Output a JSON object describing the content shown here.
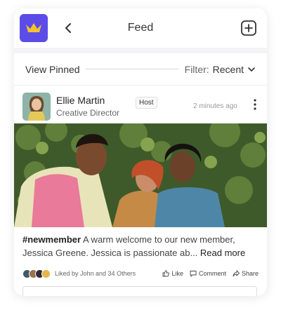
{
  "header": {
    "title": "Feed",
    "logo_icon": "crown-icon",
    "back_icon": "chevron-left-icon",
    "add_icon": "plus-square-icon",
    "brand_color": "#5b4ce8"
  },
  "filterbar": {
    "pinned_label": "View Pinned",
    "filter_label": "Filter:",
    "filter_value": "Recent"
  },
  "post": {
    "author": "Ellie Martin",
    "role": "Creative Director",
    "badge": "Host",
    "time": "2 minutes ago",
    "hashtag": "#newmember",
    "body": " A warm welcome to our new member, Jessica Greene. Jessica is passionate ab...",
    "more": " Read more",
    "liked_by": "Liked by John and 34 Others",
    "like_label": "Like",
    "comment_label": "Comment",
    "share_label": "Share"
  }
}
